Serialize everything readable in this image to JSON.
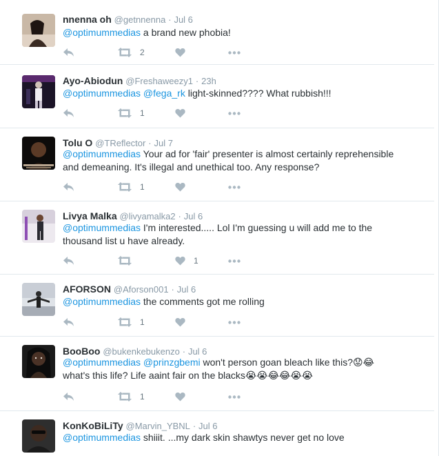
{
  "tweets": [
    {
      "name": "nnenna oh",
      "handle": "@getnnenna",
      "time": "Jul 6",
      "mention1": "@optimummedias",
      "mention2": "",
      "text": " a brand new phobia!",
      "text2": "",
      "retweets": "2",
      "likes": ""
    },
    {
      "name": "Ayo-Abiodun",
      "handle": "@Freshaweezy1",
      "time": "23h",
      "mention1": "@optimummedias",
      "mention2": "@fega_rk",
      "text": "  light-skinned????  What rubbish!!!",
      "text2": "",
      "retweets": "1",
      "likes": ""
    },
    {
      "name": "Tolu O",
      "handle": "@TReflector",
      "time": "Jul 7",
      "mention1": "@optimummedias",
      "mention2": "",
      "text": " Your ad for 'fair' presenter is almost certainly reprehensible and demeaning. It's illegal and unethical too. Any response?",
      "text2": "",
      "retweets": "1",
      "likes": ""
    },
    {
      "name": "Livya Malka",
      "handle": "@livyamalka2",
      "time": "Jul 6",
      "mention1": "@optimummedias",
      "mention2": "",
      "text": " I'm interested..... Lol I'm guessing u will add me to the thousand list u have already.",
      "text2": "",
      "retweets": "",
      "likes": "1"
    },
    {
      "name": "AFORSON",
      "handle": "@Aforson001",
      "time": "Jul 6",
      "mention1": "@optimummedias",
      "mention2": "",
      "text": " the comments got me rolling",
      "text2": "",
      "retweets": "1",
      "likes": ""
    },
    {
      "name": "BooBoo",
      "handle": "@bukenkebukenzo",
      "time": "Jul 6",
      "mention1": "@optimummedias",
      "mention2": "@prinzgbemi",
      "text": " won't person goan bleach like this?😟😂",
      "text2": "what's this life? Life aaint fair on the blacks😭😭😂😂😭😭",
      "retweets": "1",
      "likes": ""
    },
    {
      "name": "KonKoBiLiTy",
      "handle": "@Marvin_YBNL",
      "time": "Jul 6",
      "mention1": "@optimummedias",
      "mention2": "",
      "text": " shiiit. ...my dark skin shawtys never get no love",
      "text2": "",
      "retweets": "",
      "likes": ""
    }
  ],
  "separator": "·",
  "colors": {
    "mention": "#1b95e0",
    "icon": "#aab8c2",
    "meta": "#8899a6"
  }
}
